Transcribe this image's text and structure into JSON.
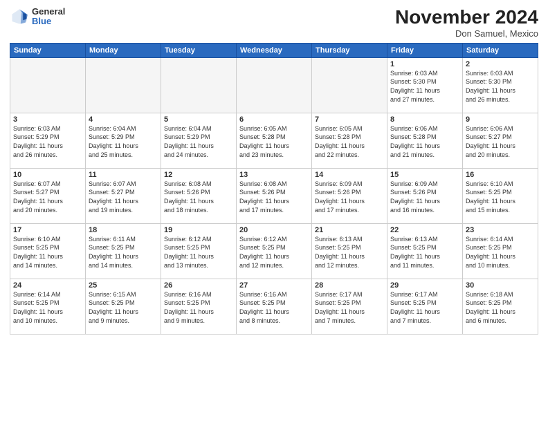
{
  "header": {
    "logo_general": "General",
    "logo_blue": "Blue",
    "month_title": "November 2024",
    "location": "Don Samuel, Mexico"
  },
  "weekdays": [
    "Sunday",
    "Monday",
    "Tuesday",
    "Wednesday",
    "Thursday",
    "Friday",
    "Saturday"
  ],
  "weeks": [
    [
      {
        "day": "",
        "info": ""
      },
      {
        "day": "",
        "info": ""
      },
      {
        "day": "",
        "info": ""
      },
      {
        "day": "",
        "info": ""
      },
      {
        "day": "",
        "info": ""
      },
      {
        "day": "1",
        "info": "Sunrise: 6:03 AM\nSunset: 5:30 PM\nDaylight: 11 hours\nand 27 minutes."
      },
      {
        "day": "2",
        "info": "Sunrise: 6:03 AM\nSunset: 5:30 PM\nDaylight: 11 hours\nand 26 minutes."
      }
    ],
    [
      {
        "day": "3",
        "info": "Sunrise: 6:03 AM\nSunset: 5:29 PM\nDaylight: 11 hours\nand 26 minutes."
      },
      {
        "day": "4",
        "info": "Sunrise: 6:04 AM\nSunset: 5:29 PM\nDaylight: 11 hours\nand 25 minutes."
      },
      {
        "day": "5",
        "info": "Sunrise: 6:04 AM\nSunset: 5:29 PM\nDaylight: 11 hours\nand 24 minutes."
      },
      {
        "day": "6",
        "info": "Sunrise: 6:05 AM\nSunset: 5:28 PM\nDaylight: 11 hours\nand 23 minutes."
      },
      {
        "day": "7",
        "info": "Sunrise: 6:05 AM\nSunset: 5:28 PM\nDaylight: 11 hours\nand 22 minutes."
      },
      {
        "day": "8",
        "info": "Sunrise: 6:06 AM\nSunset: 5:28 PM\nDaylight: 11 hours\nand 21 minutes."
      },
      {
        "day": "9",
        "info": "Sunrise: 6:06 AM\nSunset: 5:27 PM\nDaylight: 11 hours\nand 20 minutes."
      }
    ],
    [
      {
        "day": "10",
        "info": "Sunrise: 6:07 AM\nSunset: 5:27 PM\nDaylight: 11 hours\nand 20 minutes."
      },
      {
        "day": "11",
        "info": "Sunrise: 6:07 AM\nSunset: 5:27 PM\nDaylight: 11 hours\nand 19 minutes."
      },
      {
        "day": "12",
        "info": "Sunrise: 6:08 AM\nSunset: 5:26 PM\nDaylight: 11 hours\nand 18 minutes."
      },
      {
        "day": "13",
        "info": "Sunrise: 6:08 AM\nSunset: 5:26 PM\nDaylight: 11 hours\nand 17 minutes."
      },
      {
        "day": "14",
        "info": "Sunrise: 6:09 AM\nSunset: 5:26 PM\nDaylight: 11 hours\nand 17 minutes."
      },
      {
        "day": "15",
        "info": "Sunrise: 6:09 AM\nSunset: 5:26 PM\nDaylight: 11 hours\nand 16 minutes."
      },
      {
        "day": "16",
        "info": "Sunrise: 6:10 AM\nSunset: 5:25 PM\nDaylight: 11 hours\nand 15 minutes."
      }
    ],
    [
      {
        "day": "17",
        "info": "Sunrise: 6:10 AM\nSunset: 5:25 PM\nDaylight: 11 hours\nand 14 minutes."
      },
      {
        "day": "18",
        "info": "Sunrise: 6:11 AM\nSunset: 5:25 PM\nDaylight: 11 hours\nand 14 minutes."
      },
      {
        "day": "19",
        "info": "Sunrise: 6:12 AM\nSunset: 5:25 PM\nDaylight: 11 hours\nand 13 minutes."
      },
      {
        "day": "20",
        "info": "Sunrise: 6:12 AM\nSunset: 5:25 PM\nDaylight: 11 hours\nand 12 minutes."
      },
      {
        "day": "21",
        "info": "Sunrise: 6:13 AM\nSunset: 5:25 PM\nDaylight: 11 hours\nand 12 minutes."
      },
      {
        "day": "22",
        "info": "Sunrise: 6:13 AM\nSunset: 5:25 PM\nDaylight: 11 hours\nand 11 minutes."
      },
      {
        "day": "23",
        "info": "Sunrise: 6:14 AM\nSunset: 5:25 PM\nDaylight: 11 hours\nand 10 minutes."
      }
    ],
    [
      {
        "day": "24",
        "info": "Sunrise: 6:14 AM\nSunset: 5:25 PM\nDaylight: 11 hours\nand 10 minutes."
      },
      {
        "day": "25",
        "info": "Sunrise: 6:15 AM\nSunset: 5:25 PM\nDaylight: 11 hours\nand 9 minutes."
      },
      {
        "day": "26",
        "info": "Sunrise: 6:16 AM\nSunset: 5:25 PM\nDaylight: 11 hours\nand 9 minutes."
      },
      {
        "day": "27",
        "info": "Sunrise: 6:16 AM\nSunset: 5:25 PM\nDaylight: 11 hours\nand 8 minutes."
      },
      {
        "day": "28",
        "info": "Sunrise: 6:17 AM\nSunset: 5:25 PM\nDaylight: 11 hours\nand 7 minutes."
      },
      {
        "day": "29",
        "info": "Sunrise: 6:17 AM\nSunset: 5:25 PM\nDaylight: 11 hours\nand 7 minutes."
      },
      {
        "day": "30",
        "info": "Sunrise: 6:18 AM\nSunset: 5:25 PM\nDaylight: 11 hours\nand 6 minutes."
      }
    ]
  ]
}
